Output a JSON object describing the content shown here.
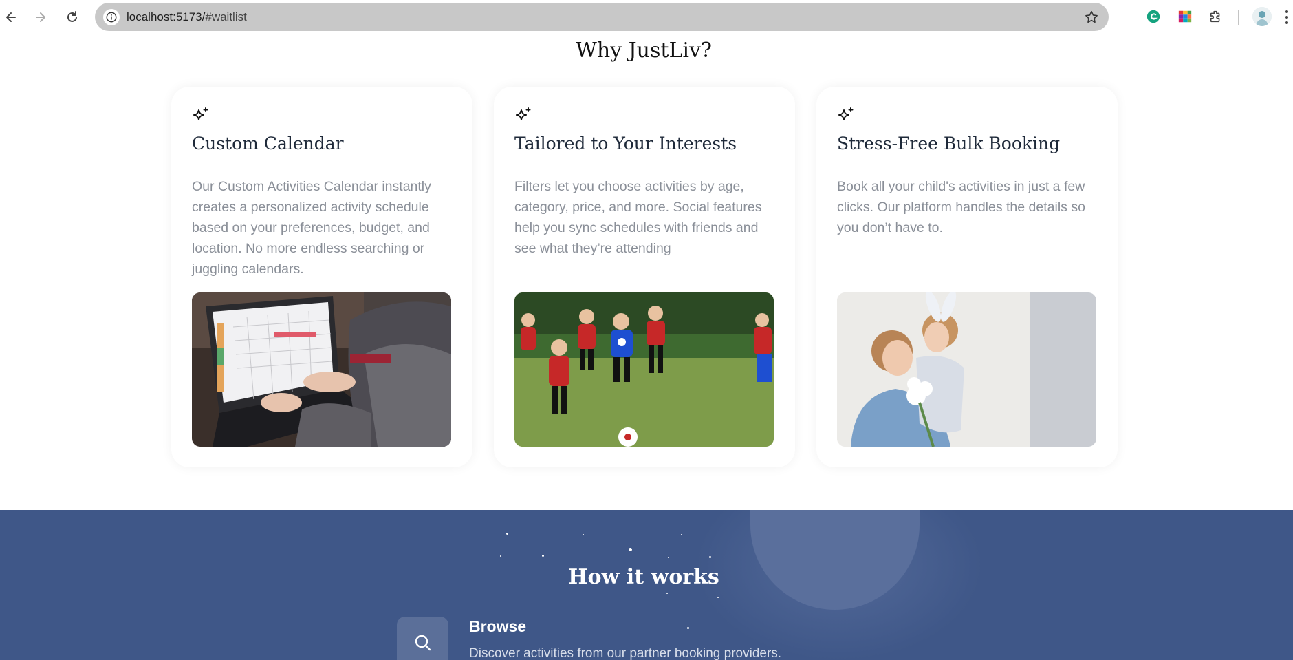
{
  "browser": {
    "url_host": "localhost:5173/",
    "url_path": "#waitlist"
  },
  "why": {
    "title": "Why JustLiv?",
    "cards": [
      {
        "title": "Custom Calendar",
        "description": "Our Custom Activities Calendar instantly creates a personalized activity schedule based on your preferences, budget, and location. No more endless searching or juggling calendars."
      },
      {
        "title": "Tailored to Your Interests",
        "description": "Filters let you choose activities by age, category, price, and more. Social features help you sync schedules with friends and see what they’re attending"
      },
      {
        "title": "Stress-Free Bulk Booking",
        "description": "Book all your child's activities in just a few clicks. Our platform handles the details so you don’t have to."
      }
    ]
  },
  "how": {
    "title": "How it works",
    "steps": [
      {
        "title": "Browse",
        "description": "Discover activities from our partner booking providers."
      }
    ]
  },
  "colors": {
    "how_bg": "#3f5788",
    "card_text": "#8a8f98"
  },
  "icons": [
    "back-arrow-icon",
    "forward-arrow-icon",
    "reload-icon",
    "info-icon",
    "star-bookmark-icon",
    "grammarly-icon",
    "extension-color-icon",
    "puzzle-extensions-icon",
    "profile-avatar",
    "kebab-menu-icon",
    "sparkle-icon",
    "search-icon"
  ]
}
